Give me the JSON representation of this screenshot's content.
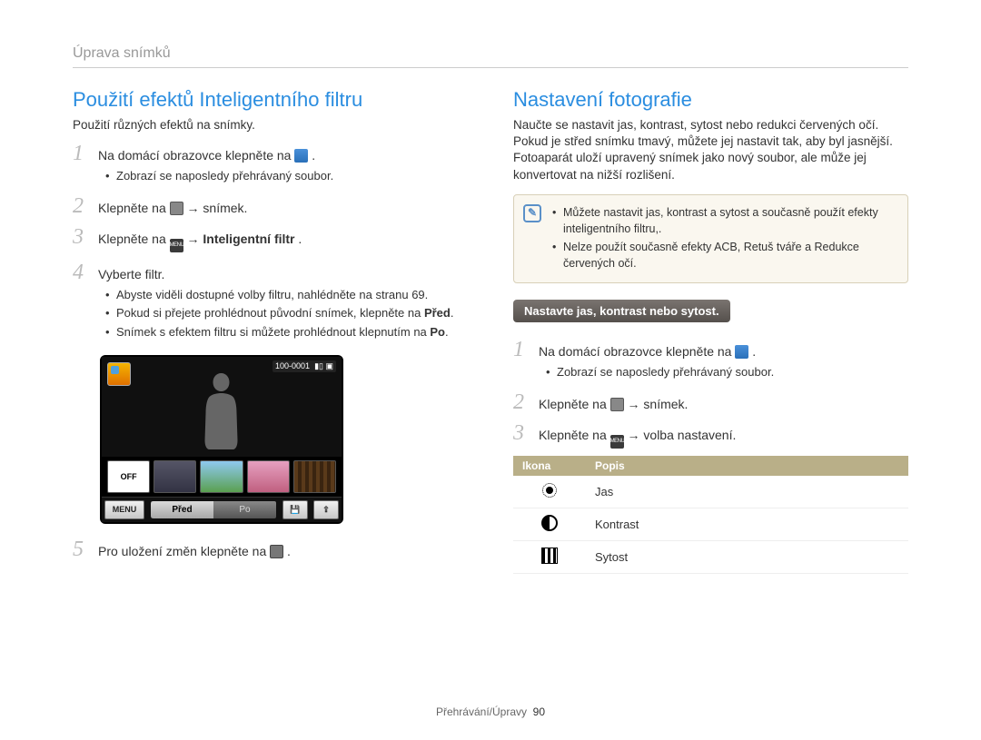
{
  "breadcrumb": "Úprava snímků",
  "left": {
    "heading": "Použití efektů Inteligentního filtru",
    "desc": "Použití různých efektů na snímky.",
    "step1": {
      "text_a": "Na domácí obrazovce klepněte na ",
      "text_b": ".",
      "bullet1": "Zobrazí se naposledy přehrávaný soubor."
    },
    "step2": {
      "text_a": "Klepněte na ",
      "arrow": " → ",
      "text_b": "snímek."
    },
    "step3": {
      "text_a": "Klepněte na ",
      "arrow": " → ",
      "bold": "Inteligentní filtr",
      "text_b": "."
    },
    "step4": {
      "text": "Vyberte filtr.",
      "bullet1": "Abyste viděli dostupné volby filtru, nahlédněte na stranu 69.",
      "bullet2_a": "Pokud si přejete prohlédnout původní snímek, klepněte na ",
      "bullet2_bold": "Před",
      "bullet2_b": ".",
      "bullet3_a": "Snímek s efektem filtru si můžete prohlédnout klepnutím na ",
      "bullet3_bold": "Po",
      "bullet3_b": "."
    },
    "step5": {
      "text_a": "Pro uložení změn klepněte na ",
      "text_b": "."
    },
    "screen": {
      "counter": "100-0001",
      "off": "OFF",
      "menu": "MENU",
      "pred": "Před",
      "po": "Po"
    },
    "menu_icon_label": "MENU"
  },
  "right": {
    "heading": "Nastavení fotografie",
    "desc": "Naučte se nastavit jas, kontrast, sytost nebo redukci červených očí. Pokud je střed snímku tmavý, můžete jej nastavit tak, aby byl jasnější. Fotoaparát uloží upravený snímek jako nový soubor, ale může jej konvertovat na nižší rozlišení.",
    "note": {
      "bullet1": "Můžete nastavit jas, kontrast a sytost a současně použít efekty inteligentního filtru,.",
      "bullet2": "Nelze použít současně efekty ACB, Retuš tváře a Redukce červených očí."
    },
    "pill": "Nastavte jas, kontrast nebo sytost.",
    "step1": {
      "text_a": "Na domácí obrazovce klepněte na ",
      "text_b": ".",
      "bullet1": "Zobrazí se naposledy přehrávaný soubor."
    },
    "step2": {
      "text_a": "Klepněte na ",
      "arrow": " → ",
      "text_b": "snímek."
    },
    "step3": {
      "text_a": "Klepněte na ",
      "arrow": " → ",
      "text_b": "volba nastavení."
    },
    "table": {
      "h1": "Ikona",
      "h2": "Popis",
      "r1": "Jas",
      "r2": "Kontrast",
      "r3": "Sytost"
    }
  },
  "footer": {
    "section": "Přehrávání/Úpravy",
    "page": "90"
  }
}
